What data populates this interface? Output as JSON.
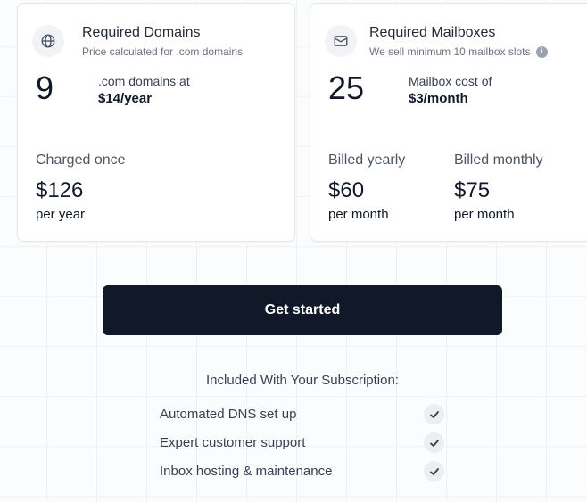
{
  "domains": {
    "title": "Required Domains",
    "subtitle": "Price calculated for .com domains",
    "icon": "globe-icon",
    "count": "9",
    "rate_line1": ".com domains at",
    "rate_line2": "$14/year",
    "billing_label": "Charged once",
    "price": "$126",
    "period": "per year"
  },
  "mailboxes": {
    "title": "Required Mailboxes",
    "subtitle": "We sell minimum 10 mailbox slots",
    "info_glyph": "i",
    "icon": "mail-icon",
    "count": "25",
    "rate_line1": "Mailbox cost of",
    "rate_line2": "$3/month",
    "yearly": {
      "label": "Billed yearly",
      "price": "$60",
      "period": "per month"
    },
    "monthly": {
      "label": "Billed monthly",
      "price": "$75",
      "period": "per month"
    }
  },
  "cta": {
    "label": "Get started"
  },
  "included": {
    "title": "Included With Your Subscription:",
    "features": [
      "Automated DNS set up",
      "Expert customer support",
      "Inbox hosting & maintenance"
    ]
  },
  "colors": {
    "primary_button": "#111827",
    "card_border": "#e5e7eb",
    "muted_text": "#6b7280"
  }
}
